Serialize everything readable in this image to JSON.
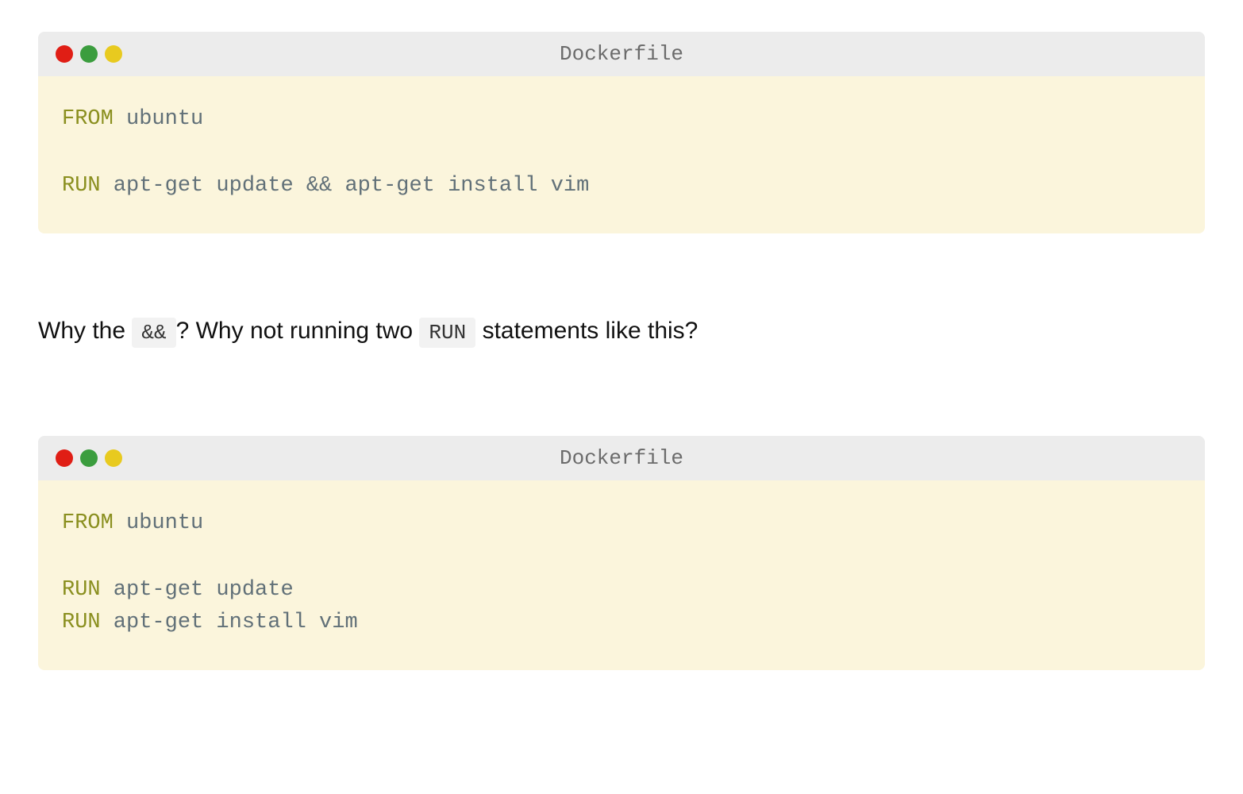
{
  "block1": {
    "title": "Dockerfile",
    "lines": [
      {
        "kw": "FROM",
        "rest": " ubuntu"
      },
      null,
      {
        "kw": "RUN",
        "rest": " apt-get update && apt-get install vim"
      }
    ]
  },
  "paragraph": {
    "part1": "Why the ",
    "code1": "&&",
    "part2": "? Why not running two ",
    "code2": "RUN",
    "part3": " statements like this?"
  },
  "block2": {
    "title": "Dockerfile",
    "lines": [
      {
        "kw": "FROM",
        "rest": " ubuntu"
      },
      null,
      {
        "kw": "RUN",
        "rest": " apt-get update"
      },
      {
        "kw": "RUN",
        "rest": " apt-get install vim"
      }
    ]
  }
}
